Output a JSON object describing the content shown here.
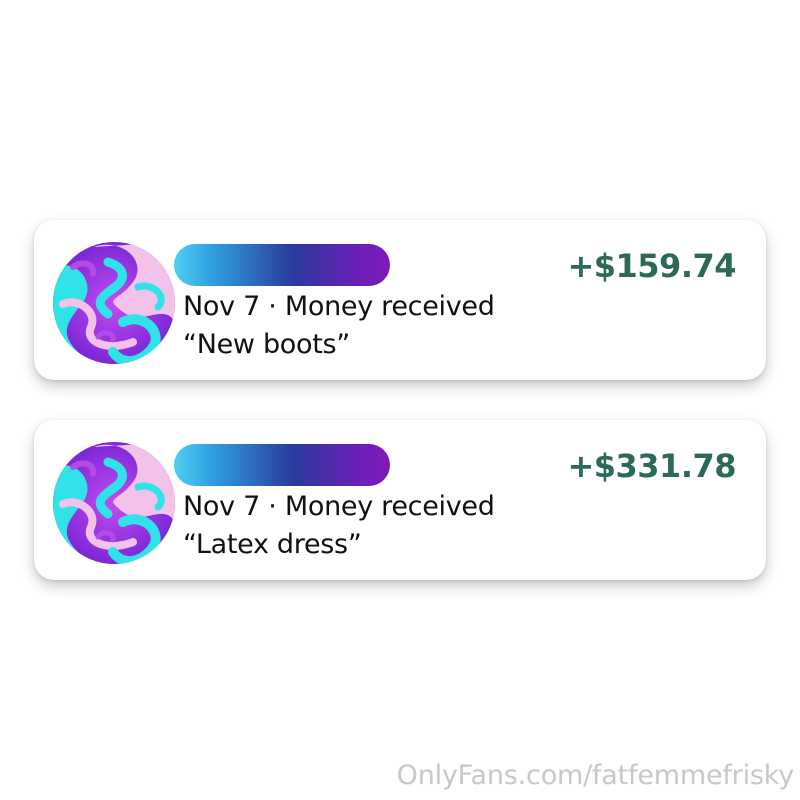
{
  "transactions": [
    {
      "date": "Nov 7",
      "separator": "·",
      "type": "Money received",
      "note": "“New boots”",
      "amount": "+$159.74"
    },
    {
      "date": "Nov 7",
      "separator": "·",
      "type": "Money received",
      "note": "“Latex dress”",
      "amount": "+$331.78"
    }
  ],
  "colors": {
    "amount": "#2d6a52",
    "name_bar_start": "#4fd0f3",
    "name_bar_mid": "#2a3a9c",
    "name_bar_end": "#7e1ab8",
    "avatar_primary": "#8a2be2",
    "avatar_secondary": "#2ee6e6",
    "avatar_highlight": "#f3c6ea"
  },
  "icons": {
    "avatar": "marbled-avatar-icon"
  },
  "watermark": "OnlyFans.com/fatfemmefrisky"
}
